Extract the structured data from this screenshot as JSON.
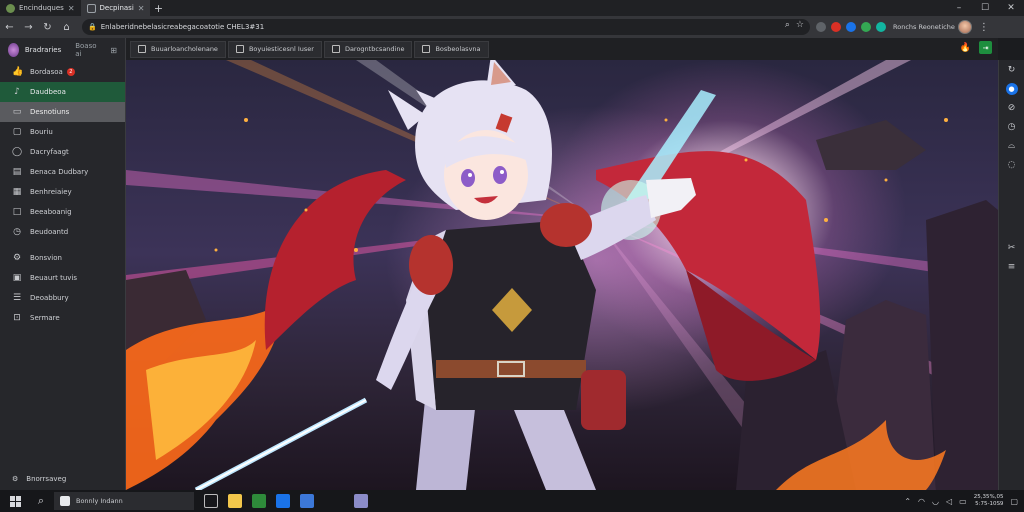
{
  "window": {
    "tabs": [
      {
        "label": "Encinduques",
        "active": false
      },
      {
        "label": "Decpinasi",
        "active": true
      }
    ],
    "controls": {
      "minimize": "–",
      "maximize": "☐",
      "close": "✕"
    }
  },
  "toolbar": {
    "url": "Enlaberidnebelasicreabegacoatotie CHEL3#31",
    "profile_label": "Ronchs Reonetiche"
  },
  "sidebar": {
    "header": {
      "name": "Bradraries",
      "secondary": "Boaso ai"
    },
    "items": [
      {
        "label": "Bordasoa",
        "icon": "thumbs-up-icon",
        "glyph": "👍",
        "badge": "2",
        "state": "normal"
      },
      {
        "label": "Daudbeoa",
        "icon": "music-note-icon",
        "glyph": "♪",
        "state": "selected-green"
      },
      {
        "label": "Desnotiuns",
        "icon": "monitor-icon",
        "glyph": "▭",
        "state": "selected-grey"
      },
      {
        "label": "Bouriu",
        "icon": "message-icon",
        "glyph": "▢",
        "state": "normal"
      },
      {
        "label": "Dacryfaagt",
        "icon": "chat-bubble-icon",
        "glyph": "◯",
        "state": "normal"
      },
      {
        "label": "Benaca Dudbary",
        "icon": "chart-icon",
        "glyph": "▤",
        "state": "normal"
      },
      {
        "label": "Benhreiaiey",
        "icon": "calendar-icon",
        "glyph": "▦",
        "state": "normal"
      },
      {
        "label": "Beeaboanig",
        "icon": "window-icon",
        "glyph": "□",
        "state": "normal"
      },
      {
        "label": "Beudoantd",
        "icon": "clock-icon",
        "glyph": "◷",
        "state": "normal"
      },
      {
        "label": "Bonsvion",
        "icon": "settings-icon",
        "glyph": "⚙",
        "state": "normal",
        "gap_before": true
      },
      {
        "label": "Beuaurt tuvis",
        "icon": "folder-icon",
        "glyph": "▣",
        "state": "normal"
      },
      {
        "label": "Deoabbury",
        "icon": "contacts-icon",
        "glyph": "☰",
        "state": "normal"
      },
      {
        "label": "Sermare",
        "icon": "gallery-icon",
        "glyph": "⊡",
        "state": "normal"
      }
    ],
    "footer": {
      "label": "Bnorrsaveg",
      "icon": "gear-icon"
    }
  },
  "pagetabs": [
    {
      "label": "Buuarloancholenane"
    },
    {
      "label": "Boyuiesticesnl Iuser"
    },
    {
      "label": "Darogntbcsandine"
    },
    {
      "label": "Bosbeolasvna"
    }
  ],
  "taskbar": {
    "search_box_label": "Bonnly Indann",
    "clock_time": "25,35%,05",
    "clock_date": "5:75-10S9"
  },
  "colors": {
    "accent_green": "#1f5a3a",
    "accent_blue": "#1a73e8",
    "badge_red": "#d93025"
  }
}
